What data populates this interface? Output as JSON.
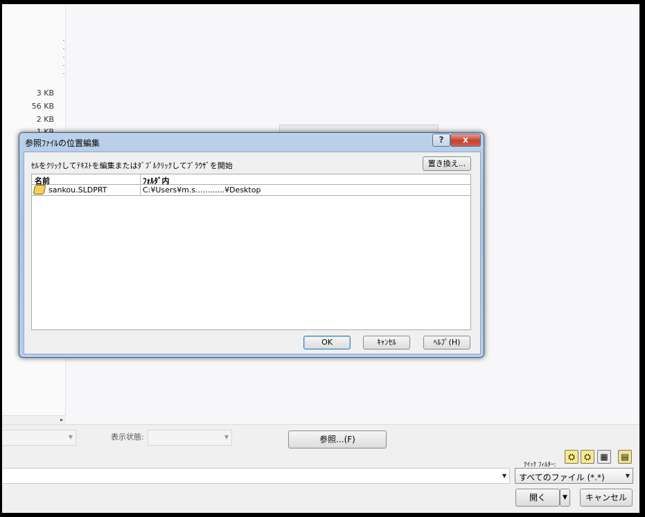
{
  "background": {
    "file_sizes": [
      "3 KB",
      "56 KB",
      "2 KB",
      "1 KB"
    ],
    "display_state_label": "表示状態:",
    "browse_button": "参照...(F)",
    "quick_filter_label": "ｸｲｯｸ ﾌｨﾙﾀｰ:",
    "file_type_value": "すべてのファイル (*.*)",
    "open_button": "開く",
    "cancel_button": "キャンセル"
  },
  "dialog": {
    "title": "参照ﾌｧｲﾙの位置編集",
    "help_icon": "?",
    "close_icon": "x",
    "instruction": "ｾﾙをｸﾘｯｸしてﾃｷｽﾄを編集またはﾀﾞﾌﾞﾙｸﾘｯｸしてﾌﾞﾗｳｻﾞを開始",
    "replace_button": "置き換え...",
    "columns": {
      "name": "名前",
      "folder": "ﾌｫﾙﾀﾞ内"
    },
    "rows": [
      {
        "name": "sankou.SLDPRT",
        "folder": "C:¥Users¥m.s............¥Desktop"
      }
    ],
    "ok_button": "OK",
    "cancel_button": "ｷｬﾝｾﾙ",
    "help_button": "ﾍﾙﾌﾟ(H)"
  }
}
